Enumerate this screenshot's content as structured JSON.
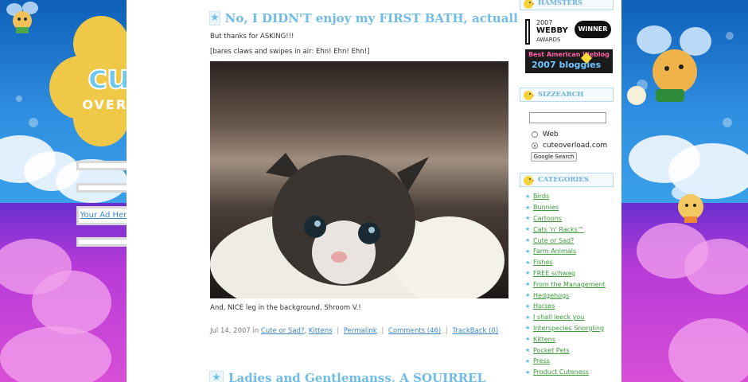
{
  "logo": {
    "word": "cute",
    "sub": "OVERLOAD"
  },
  "left_ads": {
    "link_label": "Your Ad Here"
  },
  "post": {
    "title": "No, I DIDN'T enjoy my FIRST BATH, actually",
    "line1": "But thanks for ASKING!!!",
    "line2": "[bares claws and swipes in air: Ehn! Ehn! Ehn!]",
    "caption": "And, NICE leg in the background, Shroom V.!",
    "date_prefix": "Jul 14, 2007 in",
    "cat1": "Cute or Sad?",
    "cat2": "Kittens",
    "permalink": "Permalink",
    "comments": "Comments (46)",
    "trackback": "TrackBack (0)"
  },
  "post2": {
    "title": "Ladies and Gentlemanss, A SQUIRREL"
  },
  "sidebar": {
    "hamsters_head": "HAMSTERS",
    "webby": {
      "year": "2007",
      "name": "WEBBY",
      "awards": "AWARDS",
      "winner": "WINNER"
    },
    "bloggies": {
      "line1": "Best American Weblog",
      "line2": "2007 bloggies"
    },
    "search_head": "SIZZEARCH",
    "radio_web": "Web",
    "radio_site": "cuteoverload.com",
    "search_button": "Google Search",
    "categories_head": "CATEGORIES",
    "categories": [
      "Birds",
      "Bunnies",
      "Cartoons",
      "Cats 'n' Racks™",
      "Cute or Sad?",
      "Farm Animals",
      "Fishes",
      "FREE schwag",
      "From the Management",
      "Hedgehogs",
      "Horses",
      "I shall leeck you",
      "Interspecies Snorgling",
      "Kittens",
      "Pocket Pets",
      "Press",
      "Product Cuteness"
    ]
  }
}
